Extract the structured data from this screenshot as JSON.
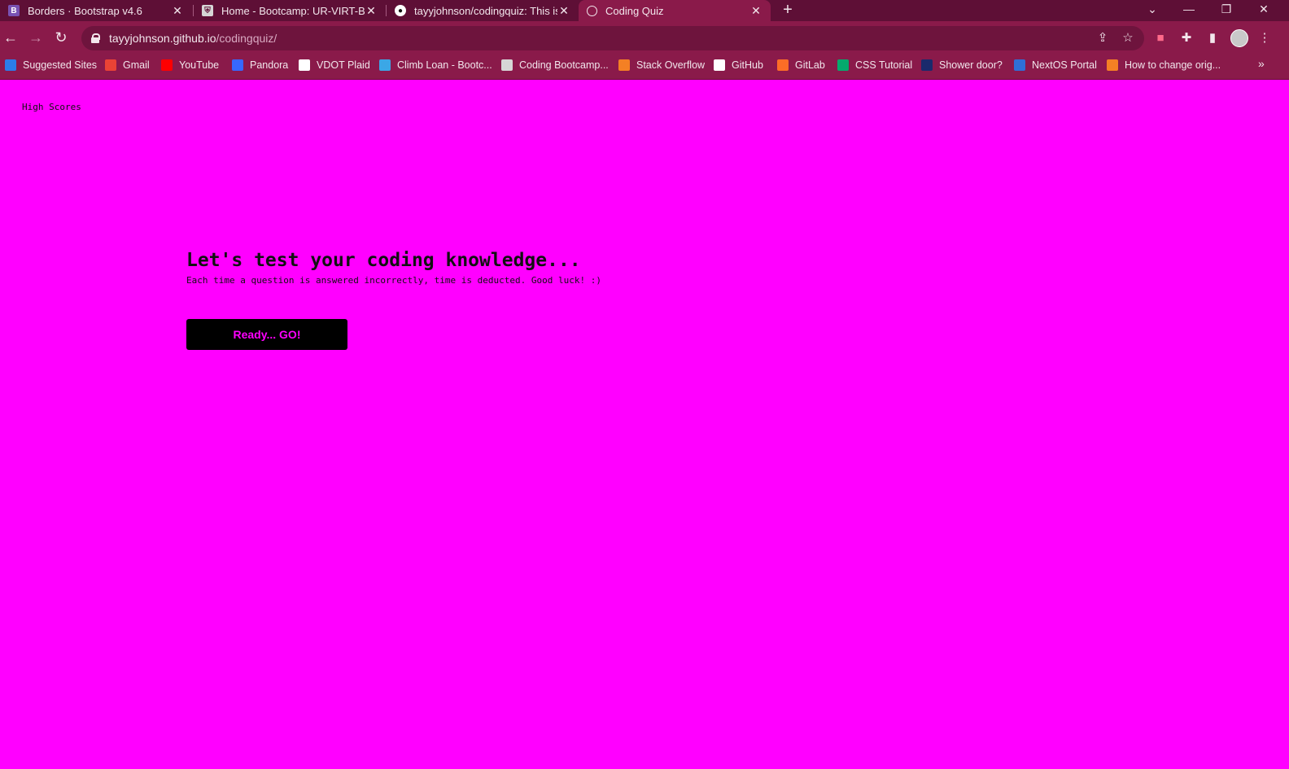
{
  "browser": {
    "tabs": [
      {
        "title": "Borders · Bootstrap v4.6",
        "favicon": "bootstrap-favicon",
        "active": false
      },
      {
        "title": "Home - Bootcamp: UR-VIRT-BO-",
        "favicon": "shield-favicon",
        "active": false
      },
      {
        "title": "tayyjohnson/codingquiz: This is t",
        "favicon": "github-favicon",
        "active": false
      },
      {
        "title": "Coding Quiz",
        "favicon": "globe-favicon",
        "active": true
      }
    ],
    "url_host": "tayyjohnson.github.io",
    "url_path": "/codingquiz/",
    "bookmarks": [
      {
        "label": "Suggested Sites",
        "icon": "bing-icon",
        "color": "#2b7de9"
      },
      {
        "label": "Gmail",
        "icon": "gmail-icon",
        "color": "#ea4335"
      },
      {
        "label": "YouTube",
        "icon": "youtube-icon",
        "color": "#ff0000"
      },
      {
        "label": "Pandora",
        "icon": "pandora-icon",
        "color": "#3668ff"
      },
      {
        "label": "VDOT Plaid",
        "icon": "vdot-icon",
        "color": "#ffffff"
      },
      {
        "label": "Climb Loan - Bootc...",
        "icon": "climb-icon",
        "color": "#3ba7e6"
      },
      {
        "label": "Coding Bootcamp...",
        "icon": "shield-icon",
        "color": "#d6d6d6"
      },
      {
        "label": "Stack Overflow",
        "icon": "stackoverflow-icon",
        "color": "#f48024"
      },
      {
        "label": "GitHub",
        "icon": "github-icon",
        "color": "#ffffff"
      },
      {
        "label": "GitLab",
        "icon": "gitlab-icon",
        "color": "#fc6d26"
      },
      {
        "label": "CSS Tutorial",
        "icon": "w3schools-icon",
        "color": "#04aa6d"
      },
      {
        "label": "Shower door?",
        "icon": "shower-icon",
        "color": "#1a2a6c"
      },
      {
        "label": "NextOS Portal",
        "icon": "person-icon",
        "color": "#2f6fd6"
      },
      {
        "label": "How to change orig...",
        "icon": "stackoverflow-icon",
        "color": "#f48024"
      }
    ]
  },
  "page": {
    "high_scores_link": "High Scores",
    "heading": "Let's test your coding knowledge...",
    "subtext": "Each time a question is answered incorrectly, time is deducted. Good luck! :)",
    "start_button": "Ready... GO!",
    "background_color": "#ff00ff",
    "button_text_color": "#ff00ff"
  }
}
